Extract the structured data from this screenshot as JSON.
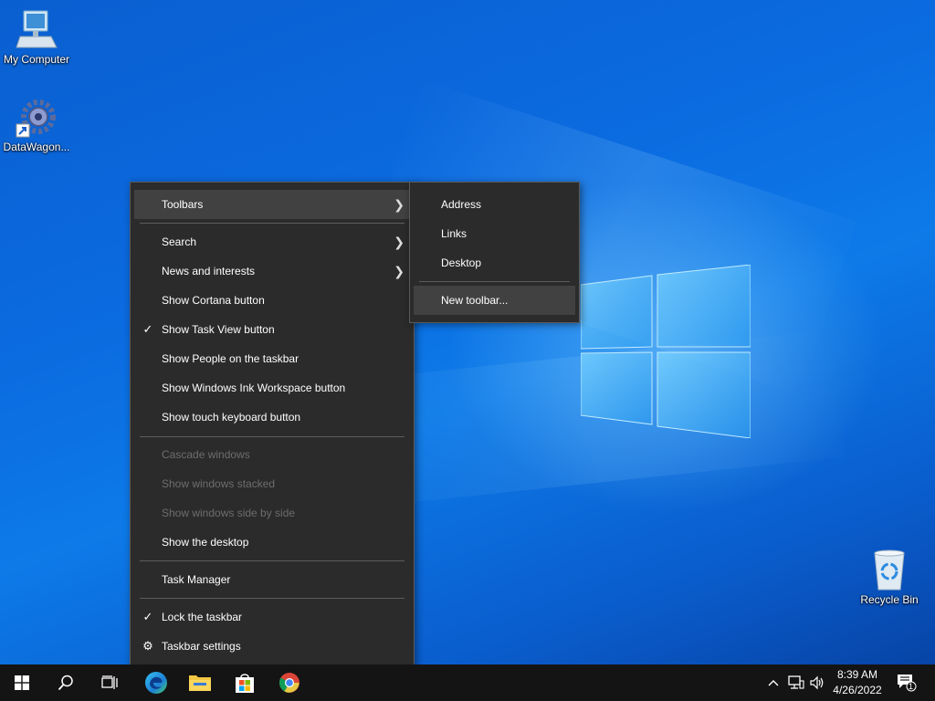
{
  "desktop": {
    "icons": [
      {
        "label": "My Computer"
      },
      {
        "label": "DataWagon..."
      },
      {
        "label": "Recycle Bin"
      }
    ]
  },
  "context_menu": {
    "items": [
      {
        "label": "Toolbars",
        "submenu": true,
        "highlighted": true
      },
      {
        "label": "Search",
        "submenu": true
      },
      {
        "label": "News and interests",
        "submenu": true
      },
      {
        "label": "Show Cortana button"
      },
      {
        "label": "Show Task View button",
        "checked": true
      },
      {
        "label": "Show People on the taskbar"
      },
      {
        "label": "Show Windows Ink Workspace button"
      },
      {
        "label": "Show touch keyboard button"
      },
      {
        "label": "Cascade windows",
        "disabled": true
      },
      {
        "label": "Show windows stacked",
        "disabled": true
      },
      {
        "label": "Show windows side by side",
        "disabled": true
      },
      {
        "label": "Show the desktop"
      },
      {
        "label": "Task Manager"
      },
      {
        "label": "Lock the taskbar",
        "checked": true
      },
      {
        "label": "Taskbar settings",
        "icon": "gear-icon"
      }
    ]
  },
  "toolbars_submenu": {
    "items": [
      {
        "label": "Address"
      },
      {
        "label": "Links"
      },
      {
        "label": "Desktop"
      },
      {
        "label": "New toolbar...",
        "highlighted": true
      }
    ]
  },
  "taskbar": {
    "icons": [
      "windows-start-icon",
      "search-icon",
      "task-view-icon",
      "edge-icon",
      "file-explorer-icon",
      "store-icon",
      "chrome-icon"
    ],
    "tray_icons": [
      "chevron-up-icon",
      "network-icon",
      "volume-icon"
    ],
    "clock": {
      "time": "8:39 AM",
      "date": "4/26/2022"
    },
    "notification_count": "1"
  },
  "colors": {
    "menu_bg": "#2b2b2b",
    "menu_highlight": "#414141",
    "taskbar_bg": "#141414",
    "desktop_blue": "#0b6be0"
  }
}
